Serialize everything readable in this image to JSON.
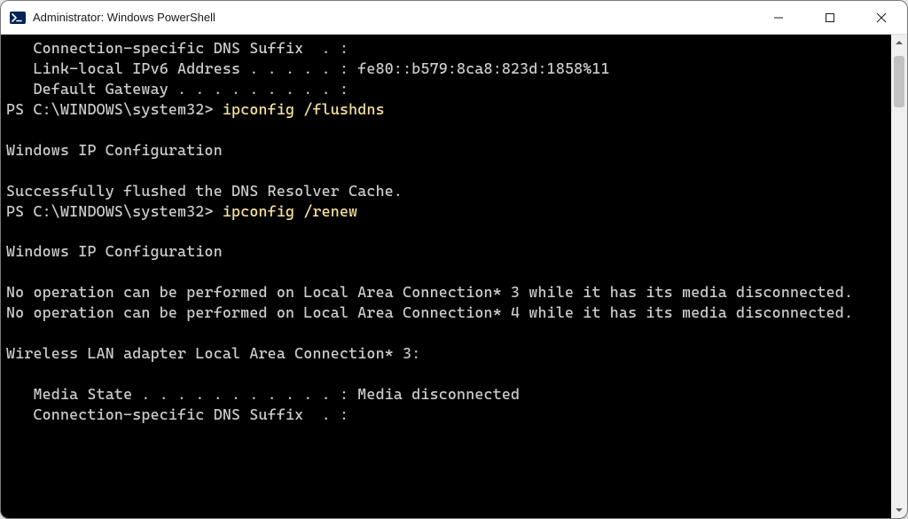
{
  "window": {
    "title": "Administrator: Windows PowerShell"
  },
  "terminal": {
    "lines": [
      {
        "indent": "   ",
        "text": "Connection-specific DNS Suffix  . :"
      },
      {
        "indent": "   ",
        "text": "Link-local IPv6 Address . . . . . : fe80::b579:8ca8:823d:1858%11"
      },
      {
        "indent": "   ",
        "text": "Default Gateway . . . . . . . . . :"
      },
      {
        "prompt": "PS C:\\WINDOWS\\system32> ",
        "command": "ipconfig /flushdns"
      },
      {
        "blank": true
      },
      {
        "text": "Windows IP Configuration"
      },
      {
        "blank": true
      },
      {
        "text": "Successfully flushed the DNS Resolver Cache."
      },
      {
        "prompt": "PS C:\\WINDOWS\\system32> ",
        "command": "ipconfig /renew"
      },
      {
        "blank": true
      },
      {
        "text": "Windows IP Configuration"
      },
      {
        "blank": true
      },
      {
        "text": "No operation can be performed on Local Area Connection* 3 while it has its media disconnected."
      },
      {
        "text": "No operation can be performed on Local Area Connection* 4 while it has its media disconnected."
      },
      {
        "blank": true
      },
      {
        "text": "Wireless LAN adapter Local Area Connection* 3:"
      },
      {
        "blank": true
      },
      {
        "indent": "   ",
        "text": "Media State . . . . . . . . . . . : Media disconnected"
      },
      {
        "indent": "   ",
        "text": "Connection-specific DNS Suffix  . :"
      }
    ],
    "wrapWidth": 103
  },
  "scrollbar": {
    "thumbTop": 24,
    "thumbHeight": 58
  }
}
